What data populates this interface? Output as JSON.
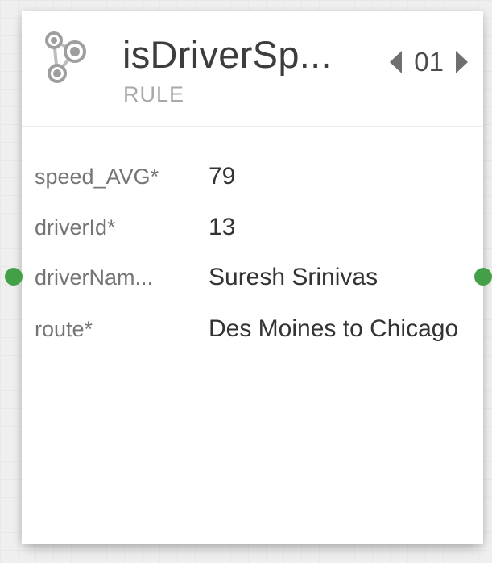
{
  "node": {
    "title": "isDriverSp...",
    "type_label": "RULE",
    "version": "01",
    "icon": "rule-nodes-icon",
    "colors": {
      "port": "#43a047",
      "title": "#3d3d3d",
      "subtitle": "#a8a8a8"
    }
  },
  "fields": [
    {
      "label": "speed_AVG*",
      "value": "79"
    },
    {
      "label": "driverId*",
      "value": "13"
    },
    {
      "label": "driverNam...",
      "value": "Suresh Srinivas"
    },
    {
      "label": "route*",
      "value": "Des Moines to Chicago"
    }
  ]
}
